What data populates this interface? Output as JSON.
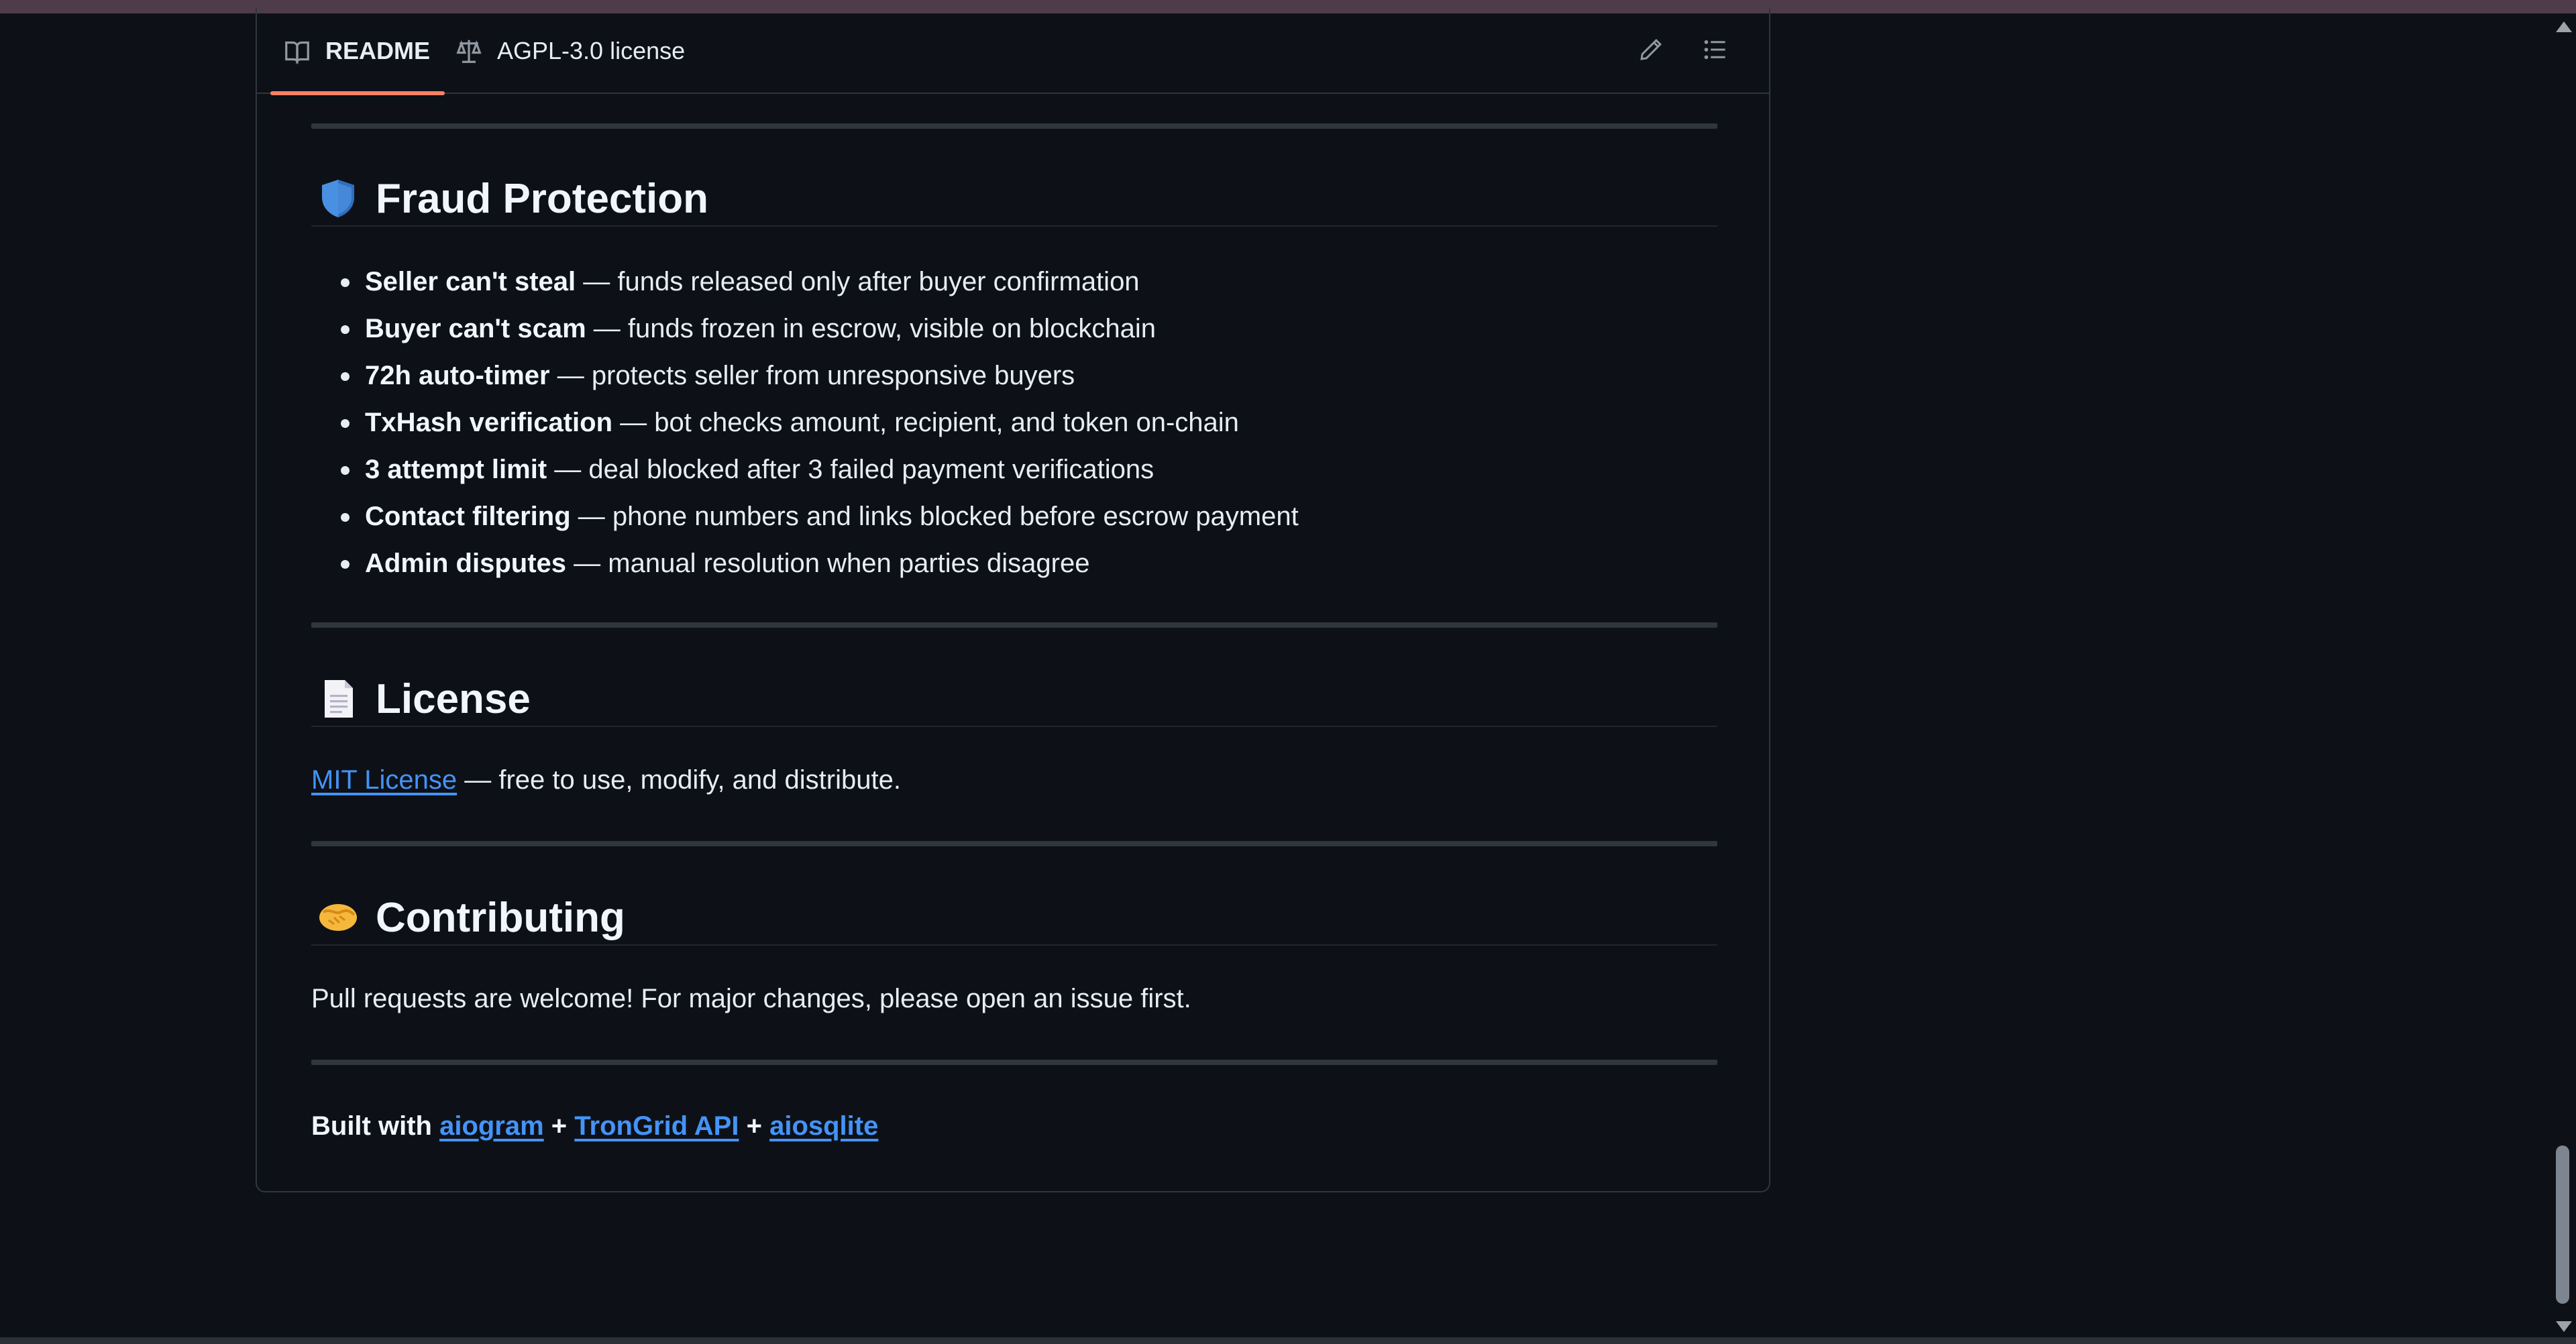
{
  "tabs": {
    "readme": "README",
    "license": "AGPL-3.0 license"
  },
  "sections": {
    "fraud": {
      "title": "Fraud Protection",
      "items": [
        {
          "bold": "Seller can't steal",
          "text": " — funds released only after buyer confirmation"
        },
        {
          "bold": "Buyer can't scam",
          "text": " — funds frozen in escrow, visible on blockchain"
        },
        {
          "bold": "72h auto-timer",
          "text": " — protects seller from unresponsive buyers"
        },
        {
          "bold": "TxHash verification",
          "text": " — bot checks amount, recipient, and token on-chain"
        },
        {
          "bold": "3 attempt limit",
          "text": " — deal blocked after 3 failed payment verifications"
        },
        {
          "bold": "Contact filtering",
          "text": " — phone numbers and links blocked before escrow payment"
        },
        {
          "bold": "Admin disputes",
          "text": " — manual resolution when parties disagree"
        }
      ]
    },
    "license": {
      "title": "License",
      "link": "MIT License",
      "text": " — free to use, modify, and distribute."
    },
    "contributing": {
      "title": "Contributing",
      "text": "Pull requests are welcome! For major changes, please open an issue first."
    },
    "footer": {
      "built_with": "Built with ",
      "plus": " + ",
      "links": [
        "aiogram",
        "TronGrid API",
        "aiosqlite"
      ]
    }
  },
  "colors": {
    "background": "#0d1117",
    "link": "#4493f8",
    "tab_underline": "#f78166",
    "border": "#30363d"
  },
  "icons": {
    "readme_tab": "book-icon",
    "license_tab": "scale-icon",
    "edit": "pencil-icon",
    "outline": "list-outline-icon",
    "fraud": "shield-emoji",
    "license": "page-emoji",
    "contributing": "handshake-emoji"
  }
}
